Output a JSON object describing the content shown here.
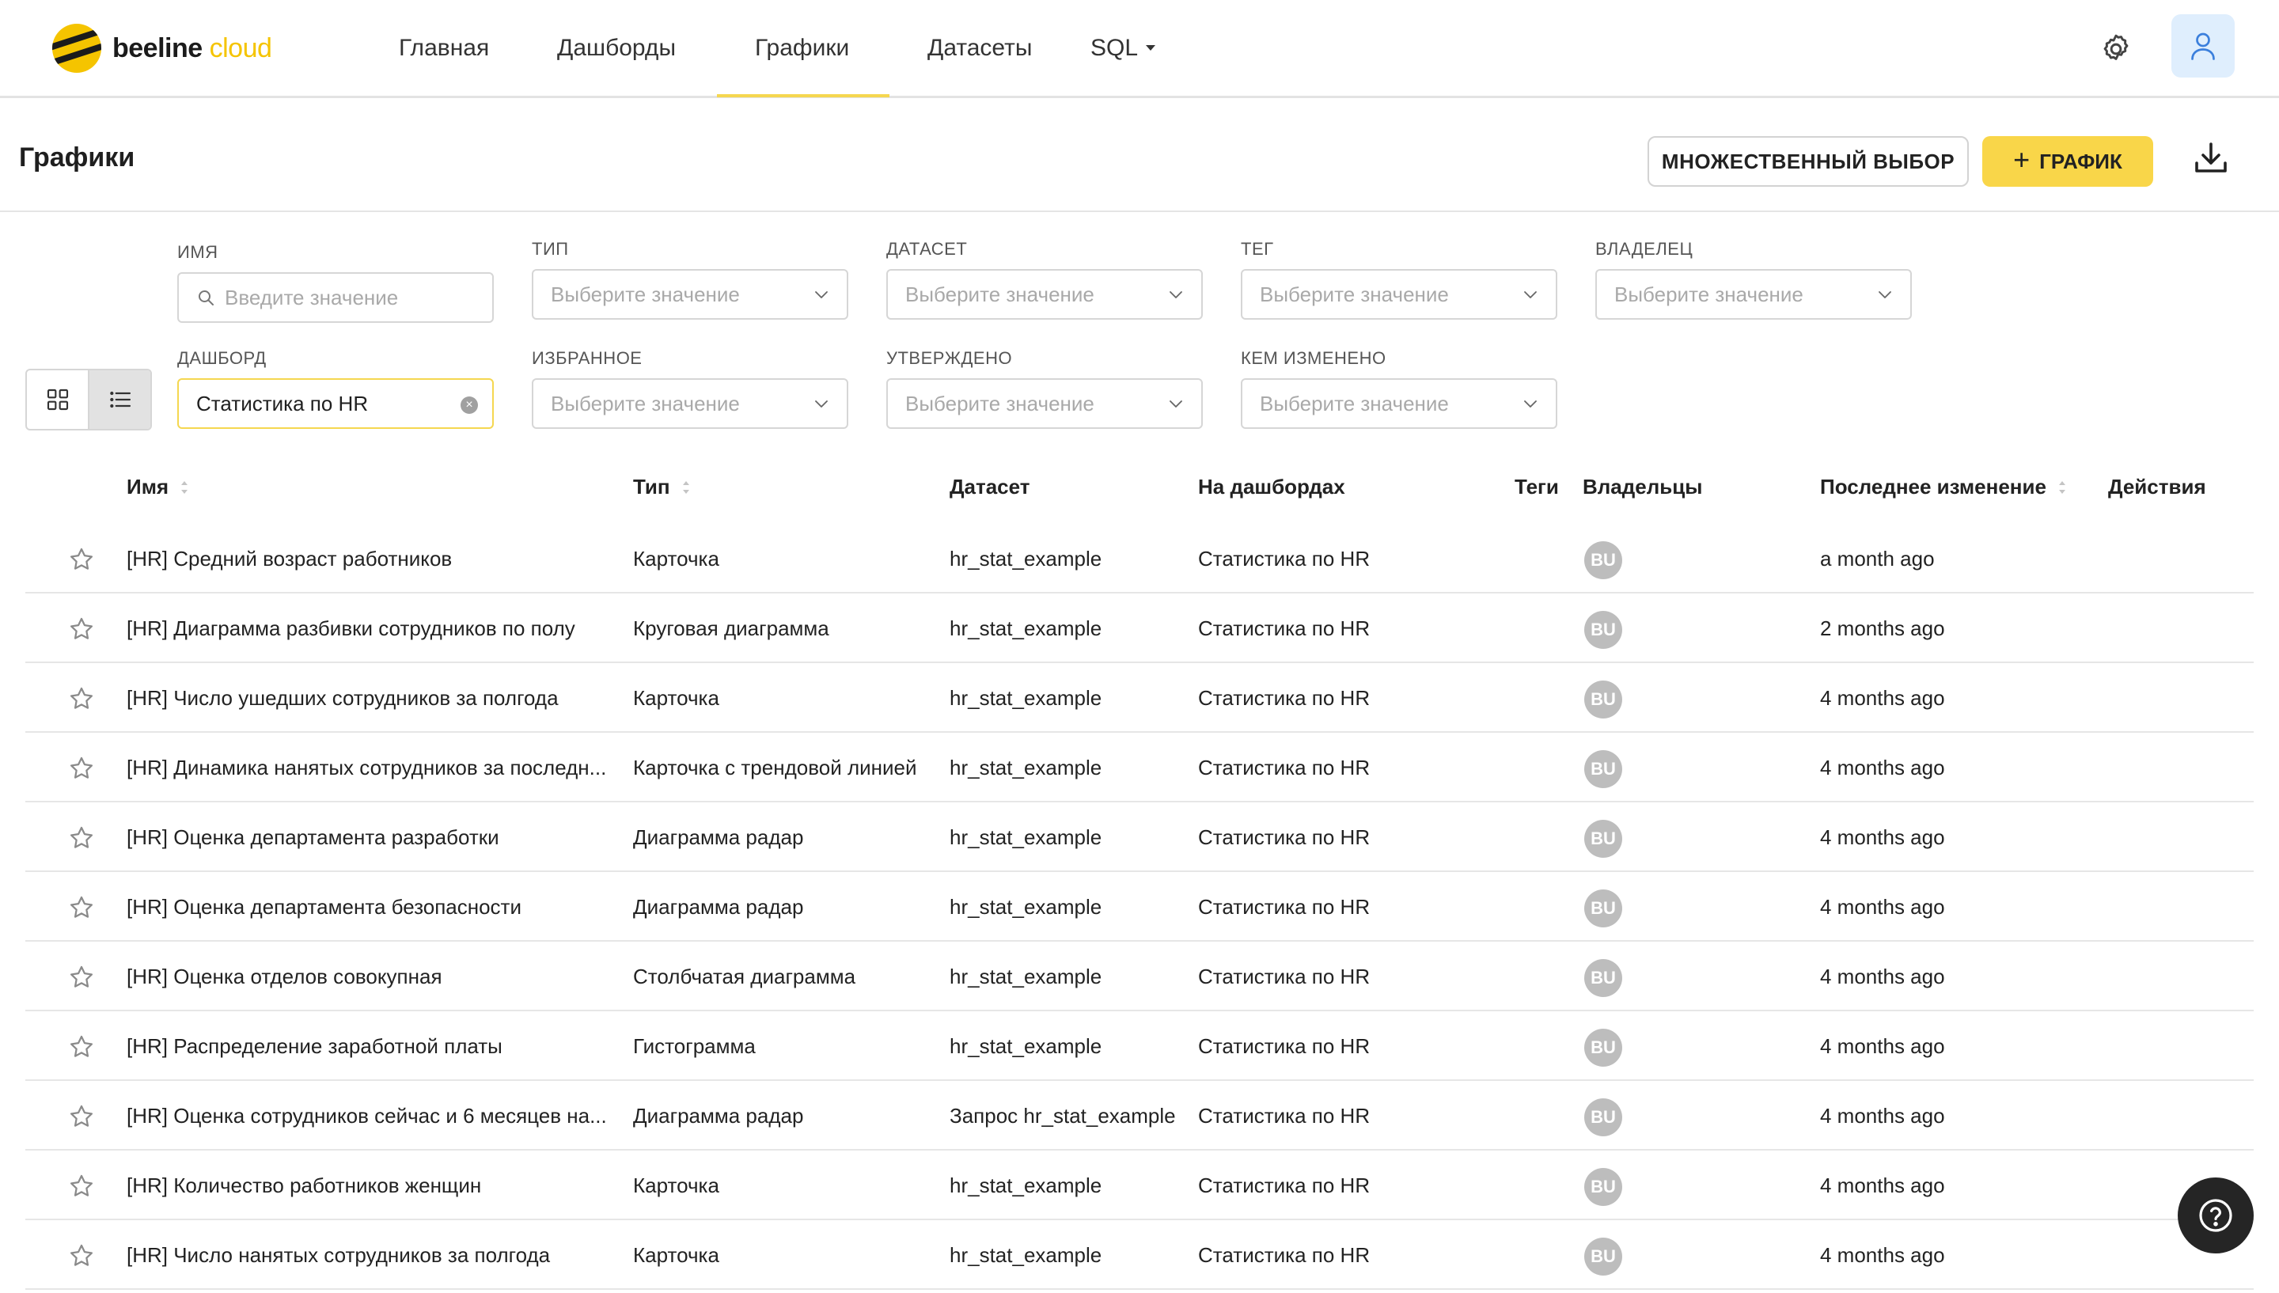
{
  "brand": {
    "name": "beeline",
    "suffix": "cloud"
  },
  "nav": {
    "items": [
      {
        "label": "Главная"
      },
      {
        "label": "Дашборды"
      },
      {
        "label": "Графики"
      },
      {
        "label": "Датасеты"
      },
      {
        "label": "SQL"
      }
    ],
    "active": "Графики"
  },
  "page": {
    "title": "Графики"
  },
  "toolbar": {
    "multi_select_label": "МНОЖЕСТВЕННЫЙ ВЫБОР",
    "add_chart_label": "ГРАФИК"
  },
  "filters": {
    "name": {
      "label": "ИМЯ",
      "placeholder": "Введите значение"
    },
    "type": {
      "label": "ТИП",
      "placeholder": "Выберите значение"
    },
    "dataset": {
      "label": "ДАТАСЕТ",
      "placeholder": "Выберите значение"
    },
    "tag": {
      "label": "ТЕГ",
      "placeholder": "Выберите значение"
    },
    "owner": {
      "label": "ВЛАДЕЛЕЦ",
      "placeholder": "Выберите значение"
    },
    "dashboard": {
      "label": "ДАШБОРД",
      "value": "Статистика по HR"
    },
    "favorite": {
      "label": "ИЗБРАННОЕ",
      "placeholder": "Выберите значение"
    },
    "approved": {
      "label": "УТВЕРЖДЕНО",
      "placeholder": "Выберите значение"
    },
    "modified_by": {
      "label": "КЕМ ИЗМЕНЕНО",
      "placeholder": "Выберите значение"
    }
  },
  "table": {
    "columns": {
      "name": "Имя",
      "type": "Тип",
      "dataset": "Датасет",
      "dashboards": "На дашбордах",
      "tags": "Теги",
      "owners": "Владельцы",
      "modified": "Последнее изменение",
      "actions": "Действия"
    },
    "rows": [
      {
        "name": "[HR] Средний возраст работников",
        "type": "Карточка",
        "dataset": "hr_stat_example",
        "dashboards": "Статистика по HR",
        "owner": "BU",
        "modified": "a month ago"
      },
      {
        "name": "[HR] Диаграмма разбивки сотрудников по полу",
        "type": "Круговая диаграмма",
        "dataset": "hr_stat_example",
        "dashboards": "Статистика по HR",
        "owner": "BU",
        "modified": "2 months ago"
      },
      {
        "name": "[HR] Число ушедших сотрудников за полгода",
        "type": "Карточка",
        "dataset": "hr_stat_example",
        "dashboards": "Статистика по HR",
        "owner": "BU",
        "modified": "4 months ago"
      },
      {
        "name": "[HR] Динамика нанятых сотрудников за последн...",
        "type": "Карточка с трендовой линией",
        "dataset": "hr_stat_example",
        "dashboards": "Статистика по HR",
        "owner": "BU",
        "modified": "4 months ago"
      },
      {
        "name": "[HR] Оценка департамента разработки",
        "type": "Диаграмма радар",
        "dataset": "hr_stat_example",
        "dashboards": "Статистика по HR",
        "owner": "BU",
        "modified": "4 months ago"
      },
      {
        "name": "[HR] Оценка департамента безопасности",
        "type": "Диаграмма радар",
        "dataset": "hr_stat_example",
        "dashboards": "Статистика по HR",
        "owner": "BU",
        "modified": "4 months ago"
      },
      {
        "name": "[HR] Оценка отделов совокупная",
        "type": "Столбчатая диаграмма",
        "dataset": "hr_stat_example",
        "dashboards": "Статистика по HR",
        "owner": "BU",
        "modified": "4 months ago"
      },
      {
        "name": "[HR] Распределение заработной платы",
        "type": "Гистограмма",
        "dataset": "hr_stat_example",
        "dashboards": "Статистика по HR",
        "owner": "BU",
        "modified": "4 months ago"
      },
      {
        "name": "[HR] Оценка сотрудников сейчас и 6 месяцев на...",
        "type": "Диаграмма радар",
        "dataset": "Запрос hr_stat_example",
        "dashboards": "Статистика по HR",
        "owner": "BU",
        "modified": "4 months ago"
      },
      {
        "name": "[HR] Количество работников женщин",
        "type": "Карточка",
        "dataset": "hr_stat_example",
        "dashboards": "Статистика по HR",
        "owner": "BU",
        "modified": "4 months ago"
      },
      {
        "name": "[HR] Число нанятых сотрудников за полгода",
        "type": "Карточка",
        "dataset": "hr_stat_example",
        "dashboards": "Статистика по HR",
        "owner": "BU",
        "modified": "4 months ago"
      }
    ]
  },
  "icons": {
    "logo": "beeline-logo-icon",
    "settings": "gear-icon",
    "user": "user-icon",
    "download": "download-icon",
    "search": "search-icon",
    "chevron": "chevron-down-icon",
    "clear": "clear-icon",
    "grid_view": "grid-view-icon",
    "list_view": "list-view-icon",
    "sort": "sort-icon",
    "favorite": "star-icon",
    "help": "help-icon"
  },
  "colors": {
    "accent": "#f9d649",
    "brand_yellow": "#f5c400",
    "user_button_bg": "#dfeefd",
    "avatar_bg": "#bdbdbd"
  }
}
